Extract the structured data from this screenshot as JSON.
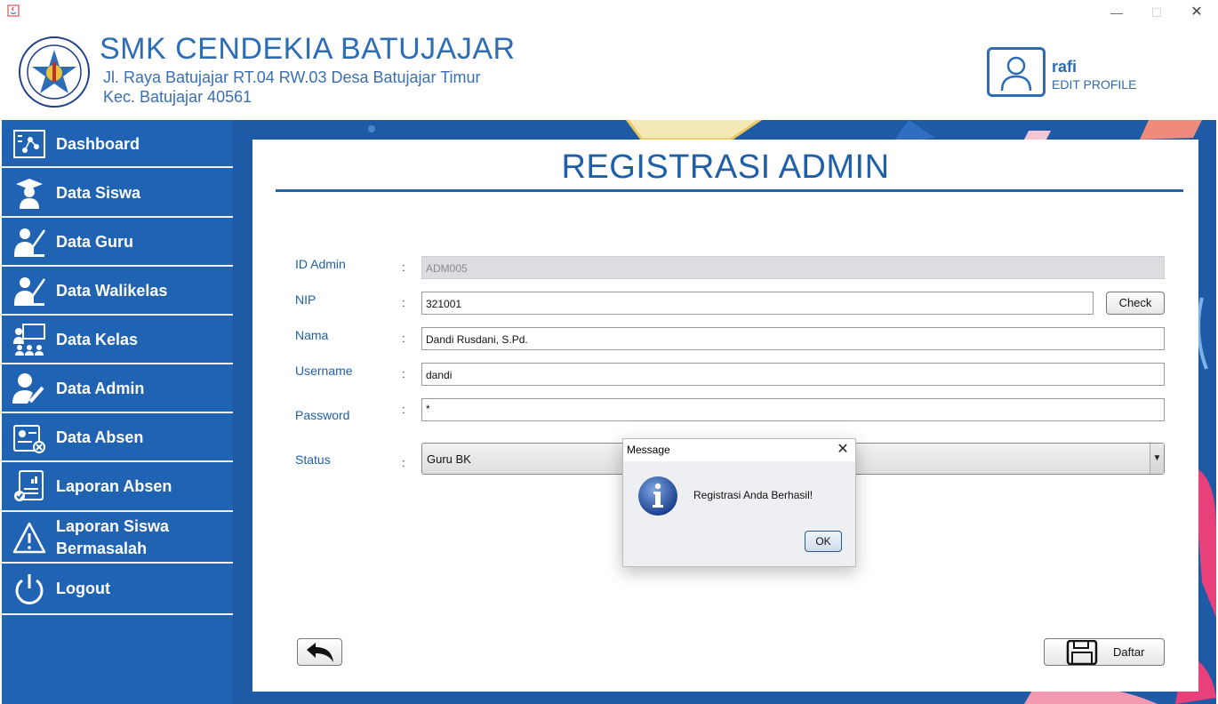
{
  "window": {
    "controls": {
      "minimize": "—",
      "maximize": "☐",
      "close": "✕"
    }
  },
  "header": {
    "school_name": "SMK CENDEKIA BATUJAJAR",
    "address_line1": "Jl. Raya Batujajar RT.04 RW.03 Desa Batujajar Timur",
    "address_line2": "Kec. Batujajar 40561",
    "logo_text": "SMK CENDEKIA BATUJAJAR",
    "logo_text_bottom": "YAYASAN PUTRA CENDEKIA",
    "user_name": "rafi",
    "edit_profile": "EDIT PROFILE"
  },
  "sidebar": {
    "items": [
      {
        "label": "Dashboard",
        "icon": "dashboard-icon"
      },
      {
        "label": "Data Siswa",
        "icon": "student-icon"
      },
      {
        "label": "Data Guru",
        "icon": "teacher-icon"
      },
      {
        "label": "Data Walikelas",
        "icon": "homeroom-teacher-icon"
      },
      {
        "label": "Data Kelas",
        "icon": "classroom-icon"
      },
      {
        "label": "Data Admin",
        "icon": "admin-icon"
      },
      {
        "label": "Data Absen",
        "icon": "attendance-icon"
      },
      {
        "label": "Laporan Absen",
        "icon": "report-icon"
      },
      {
        "label": "Laporan Siswa",
        "label2": "Bermasalah",
        "icon": "warning-icon"
      },
      {
        "label": "Logout",
        "icon": "power-icon"
      }
    ]
  },
  "form": {
    "title": "REGISTRASI ADMIN",
    "colon": ":",
    "fields": {
      "id_admin": {
        "label": "ID Admin",
        "value": "ADM005"
      },
      "nip": {
        "label": "NIP",
        "value": "321001"
      },
      "nama": {
        "label": "Nama",
        "value": "Dandi Rusdani, S.Pd."
      },
      "username": {
        "label": "Username",
        "value": "dandi"
      },
      "password": {
        "label": "Password",
        "value": "*"
      },
      "status": {
        "label": "Status",
        "value": "Guru BK"
      }
    },
    "check_button": "Check",
    "daftar_button": "Daftar"
  },
  "dialog": {
    "title": "Message",
    "message": "Registrasi Anda Berhasil!",
    "ok_button": "OK"
  },
  "colors": {
    "primary_blue": "#1f63b2",
    "title_blue": "#1f5fa8",
    "background": "#ffffff"
  }
}
